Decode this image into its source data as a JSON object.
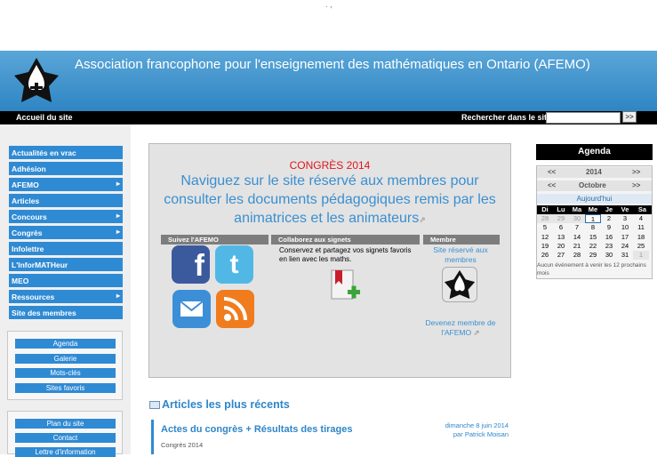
{
  "stray_text": ". ,",
  "site_title": "Association francophone pour l'enseignement des mathématiques en Ontario (AFEMO)",
  "topbar": {
    "home": "Accueil du site",
    "search_label": "Rechercher dans le site",
    "search_value": "",
    "search_button": ">>"
  },
  "sidebar": {
    "items": [
      {
        "label": "Actualités en vrac",
        "submenu": false
      },
      {
        "label": "Adhésion",
        "submenu": false
      },
      {
        "label": "AFEMO",
        "submenu": true
      },
      {
        "label": "Articles",
        "submenu": false
      },
      {
        "label": "Concours",
        "submenu": true
      },
      {
        "label": "Congrès",
        "submenu": true
      },
      {
        "label": "Infolettre",
        "submenu": false
      },
      {
        "label": "L'InforMATHeur",
        "submenu": false
      },
      {
        "label": "MEO",
        "submenu": false
      },
      {
        "label": "Ressources",
        "submenu": true
      },
      {
        "label": "Site des membres",
        "submenu": false
      }
    ],
    "arrow": "▸",
    "box1": [
      "Agenda",
      "Galerie",
      "Mots-clés",
      "Sites favoris"
    ],
    "box2": [
      "Plan du site",
      "Contact",
      "Lettre d'information"
    ]
  },
  "main": {
    "congres": "CONGRÈS 2014",
    "headline": "Naviguez sur le site réservé aux membres pour consulter les documents pédagogiques remis par les animatrices et les animateurs",
    "external_icon": "⇗",
    "col1": "Suivez l'AFEMO",
    "col2": "Collaborez aux signets",
    "col3": "Membre",
    "collab_text": "Conservez et partagez vos signets favoris en lien avec les maths.",
    "member_link": "Site réservé aux membres",
    "become_link": "Devenez membre de l'AFEMO",
    "icons": [
      "facebook-icon",
      "twitter-icon",
      "mail-icon",
      "rss-icon",
      "bookmark-add-icon"
    ]
  },
  "articles": {
    "heading": "Articles les plus récents",
    "items": [
      {
        "title": "Actes du congrès + Résultats des tirages",
        "category": "Congrès 2014",
        "date": "dimanche 8 juin 2014",
        "author": "par  Patrick Moisan"
      }
    ]
  },
  "agenda": {
    "title": "Agenda",
    "year": "2014",
    "month": "Octobre",
    "prev": "<<",
    "next": ">>",
    "today_label": "Aujourd'hui",
    "days": [
      "Di",
      "Lu",
      "Ma",
      "Me",
      "Je",
      "Ve",
      "Sa"
    ],
    "weeks": [
      [
        "28",
        "29",
        "30",
        "1",
        "2",
        "3",
        "4"
      ],
      [
        "5",
        "6",
        "7",
        "8",
        "9",
        "10",
        "11"
      ],
      [
        "12",
        "13",
        "14",
        "15",
        "16",
        "17",
        "18"
      ],
      [
        "19",
        "20",
        "21",
        "22",
        "23",
        "24",
        "25"
      ],
      [
        "26",
        "27",
        "28",
        "29",
        "30",
        "31",
        "1"
      ]
    ],
    "note": "Aucun événement à venir les 12 prochains mois"
  }
}
